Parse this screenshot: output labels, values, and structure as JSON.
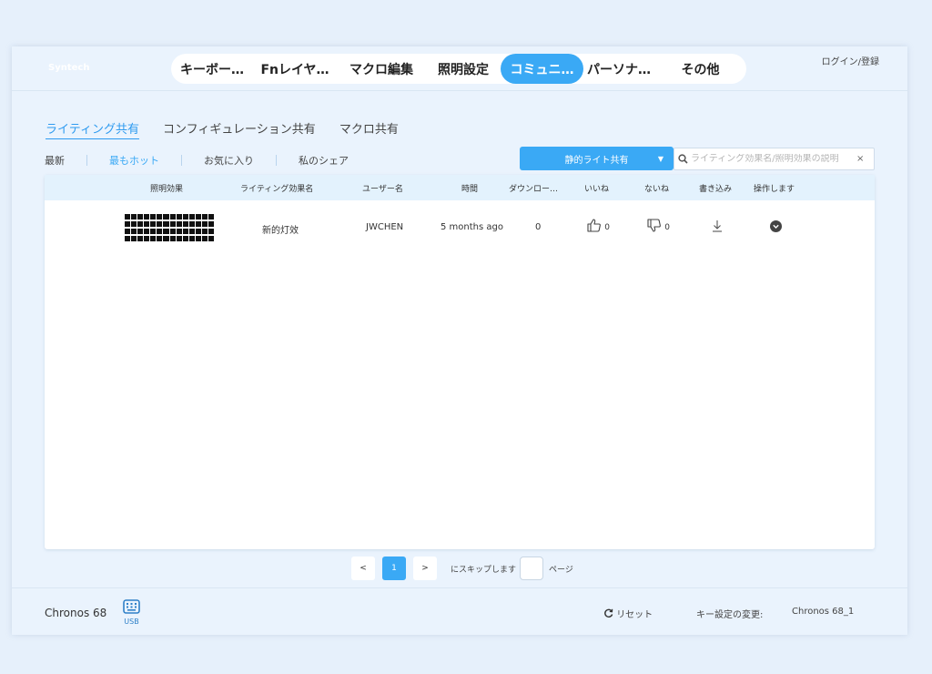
{
  "header": {
    "brand": "Syntech",
    "nav": [
      {
        "label": "キーボー…"
      },
      {
        "label": "Fnレイヤ…"
      },
      {
        "label": "マクロ編集"
      },
      {
        "label": "照明設定"
      },
      {
        "label": "コミュニ…",
        "active": true
      },
      {
        "label": "パーソナ…"
      },
      {
        "label": "その他"
      }
    ],
    "login": "ログイン/登録"
  },
  "subtabs": [
    "ライティング共有",
    "コンフィギュレーション共有",
    "マクロ共有"
  ],
  "filters": [
    "最新",
    "最もホット",
    "お気に入り",
    "私のシェア"
  ],
  "share_select": {
    "value": "静的ライト共有",
    "caret": "▼"
  },
  "search": {
    "placeholder": "ライティング効果名/照明効果の説明",
    "clear": "×"
  },
  "table": {
    "columns": [
      "照明効果",
      "ライティング効果名",
      "ユーザー名",
      "時間",
      "ダウンロー…",
      "いいね",
      "ないね",
      "書き込み",
      "操作します"
    ],
    "rows": [
      {
        "name": "新的灯效",
        "user": "JWCHEN",
        "time": "5 months ago",
        "downloads": "0",
        "likes": "0",
        "dislikes": "0"
      }
    ]
  },
  "pagination": {
    "prev": "<",
    "current": "1",
    "next": ">",
    "skip_label": "にスキップします",
    "page_label": "ページ"
  },
  "footer": {
    "device": "Chronos 68",
    "connection": "USB",
    "reset": "リセット",
    "key_settings_label": "キー設定の変更:",
    "profile": "Chronos 68_1"
  },
  "colors": {
    "accent": "#3aa9f5",
    "background": "#e6f0fb",
    "header_row": "#e3f2fd"
  }
}
